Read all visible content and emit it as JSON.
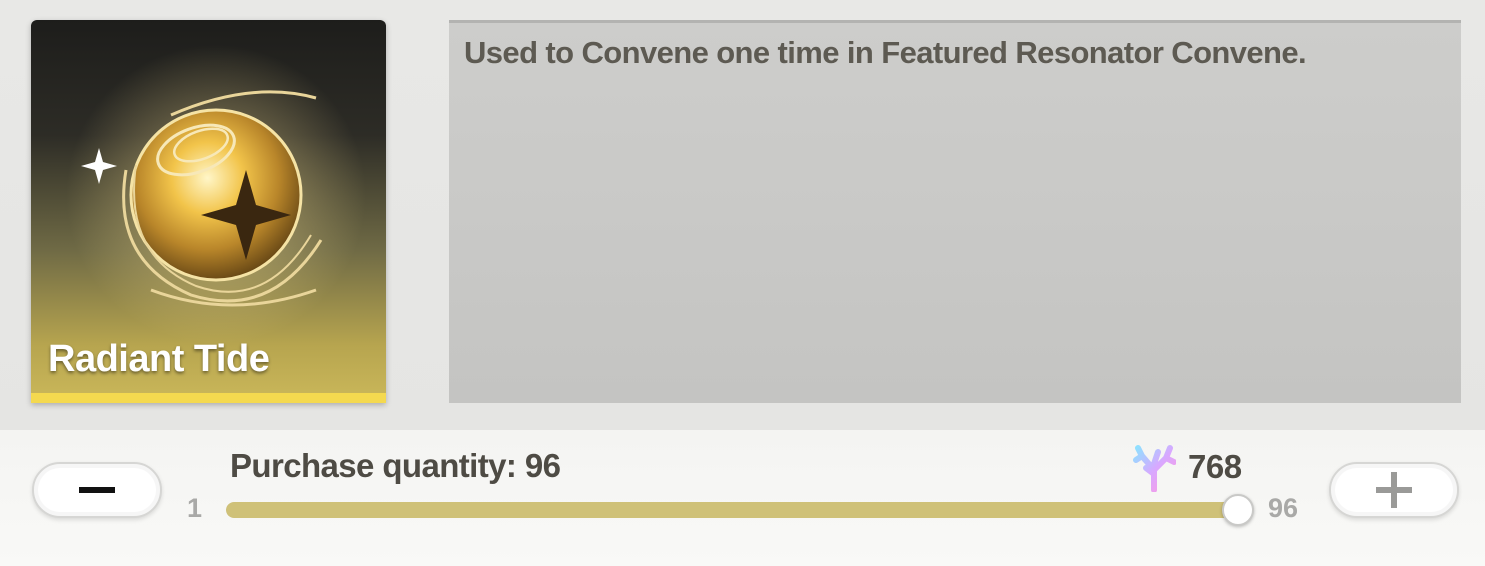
{
  "item": {
    "name": "Radiant Tide",
    "icon": "radiant-tide-orb-icon",
    "rarity_color": "#f4d94f"
  },
  "description": "Used to Convene one time in Featured Resonator Convene.",
  "purchase": {
    "label": "Purchase quantity: 96",
    "quantity": 96,
    "min": "1",
    "max": "96",
    "fill_fraction": 1.0,
    "cost": "768",
    "currency_icon": "coral-icon"
  },
  "buttons": {
    "decrease_icon": "minus-icon",
    "increase_icon": "plus-icon"
  }
}
